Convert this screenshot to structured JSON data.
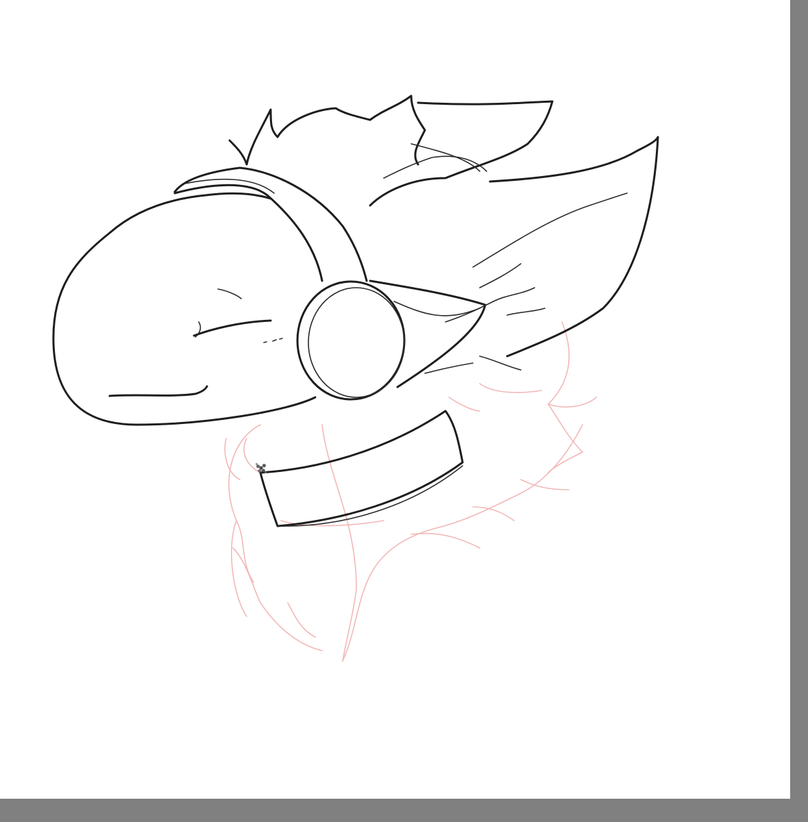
{
  "app": {
    "background_color": "#808080",
    "canvas_color": "#ffffff"
  },
  "drawing": {
    "ink_color": "#1e1e1e",
    "sketch_color": "#f2b8b8",
    "tool_icon": "brush-cursor-icon"
  }
}
